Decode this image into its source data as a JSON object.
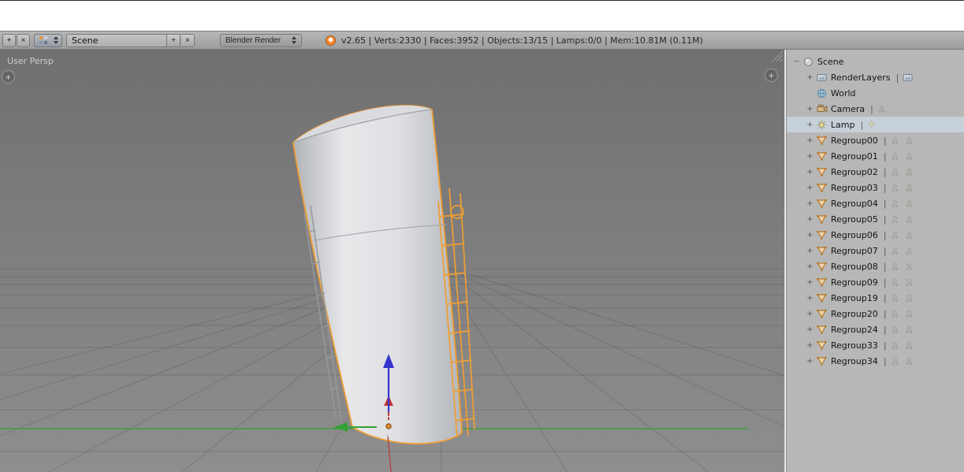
{
  "header": {
    "new_button": "+",
    "delete_button": "×",
    "scene_field": {
      "value": "Scene",
      "add_button": "+",
      "unlink_button": "×"
    },
    "engine_select": {
      "value": "Blender Render"
    },
    "stats": "v2.65 | Verts:2330 | Faces:3952 | Objects:13/15 | Lamps:0/0 | Mem:10.81M (0.11M)"
  },
  "viewport": {
    "view_label": "User Persp",
    "toolshelf_toggle": "+",
    "properties_toggle": "+"
  },
  "outliner": {
    "separator": "|",
    "toggle_expand": "+",
    "toggle_collapse": "−",
    "rows": [
      {
        "label": "Scene",
        "icon": "scene",
        "indent": 0,
        "toggle": "collapse",
        "right_icons": [],
        "selected": false
      },
      {
        "label": "RenderLayers",
        "icon": "renderlayers",
        "indent": 1,
        "toggle": "expand",
        "right_icons": [
          "renderlayers-toggle"
        ],
        "selected": false
      },
      {
        "label": "World",
        "icon": "world",
        "indent": 1,
        "toggle": "none",
        "right_icons": [],
        "selected": false
      },
      {
        "label": "Camera",
        "icon": "camera",
        "indent": 1,
        "toggle": "expand",
        "right_icons": [
          "restrict"
        ],
        "selected": false
      },
      {
        "label": "Lamp",
        "icon": "lamp",
        "indent": 1,
        "toggle": "expand",
        "right_icons": [
          "lamp-dim"
        ],
        "selected": true
      },
      {
        "label": "Regroup00",
        "icon": "mesh",
        "indent": 1,
        "toggle": "expand",
        "right_icons": [
          "restrict",
          "restrict"
        ],
        "selected": false
      },
      {
        "label": "Regroup01",
        "icon": "mesh",
        "indent": 1,
        "toggle": "expand",
        "right_icons": [
          "restrict",
          "restrict"
        ],
        "selected": false
      },
      {
        "label": "Regroup02",
        "icon": "mesh",
        "indent": 1,
        "toggle": "expand",
        "right_icons": [
          "restrict",
          "restrict"
        ],
        "selected": false
      },
      {
        "label": "Regroup03",
        "icon": "mesh",
        "indent": 1,
        "toggle": "expand",
        "right_icons": [
          "restrict",
          "restrict"
        ],
        "selected": false
      },
      {
        "label": "Regroup04",
        "icon": "mesh",
        "indent": 1,
        "toggle": "expand",
        "right_icons": [
          "restrict",
          "restrict"
        ],
        "selected": false
      },
      {
        "label": "Regroup05",
        "icon": "mesh",
        "indent": 1,
        "toggle": "expand",
        "right_icons": [
          "restrict",
          "restrict"
        ],
        "selected": false
      },
      {
        "label": "Regroup06",
        "icon": "mesh",
        "indent": 1,
        "toggle": "expand",
        "right_icons": [
          "restrict",
          "restrict"
        ],
        "selected": false
      },
      {
        "label": "Regroup07",
        "icon": "mesh",
        "indent": 1,
        "toggle": "expand",
        "right_icons": [
          "restrict",
          "restrict"
        ],
        "selected": false
      },
      {
        "label": "Regroup08",
        "icon": "mesh",
        "indent": 1,
        "toggle": "expand",
        "right_icons": [
          "restrict",
          "restrict"
        ],
        "selected": false
      },
      {
        "label": "Regroup09",
        "icon": "mesh",
        "indent": 1,
        "toggle": "expand",
        "right_icons": [
          "restrict",
          "restrict"
        ],
        "selected": false
      },
      {
        "label": "Regroup19",
        "icon": "mesh",
        "indent": 1,
        "toggle": "expand",
        "right_icons": [
          "restrict",
          "restrict"
        ],
        "selected": false
      },
      {
        "label": "Regroup20",
        "icon": "mesh",
        "indent": 1,
        "toggle": "expand",
        "right_icons": [
          "restrict",
          "restrict"
        ],
        "selected": false
      },
      {
        "label": "Regroup24",
        "icon": "mesh",
        "indent": 1,
        "toggle": "expand",
        "right_icons": [
          "restrict",
          "restrict"
        ],
        "selected": false
      },
      {
        "label": "Regroup33",
        "icon": "mesh",
        "indent": 1,
        "toggle": "expand",
        "right_icons": [
          "restrict",
          "restrict"
        ],
        "selected": false
      },
      {
        "label": "Regroup34",
        "icon": "mesh",
        "indent": 1,
        "toggle": "expand",
        "right_icons": [
          "restrict",
          "restrict"
        ],
        "selected": false
      }
    ]
  },
  "colors": {
    "selection_outline": "#ef9e33",
    "axis_y_green": "#3f9e3f",
    "axis_x_red": "#b24848",
    "gizmo_blue": "#3535cc",
    "viewport_top": "#707070",
    "viewport_bottom": "#8e8e8e",
    "outliner_bg": "#b7b7b7",
    "outliner_selected_bg": "#c6d0d9",
    "header_bg": "#a8a8a8"
  }
}
